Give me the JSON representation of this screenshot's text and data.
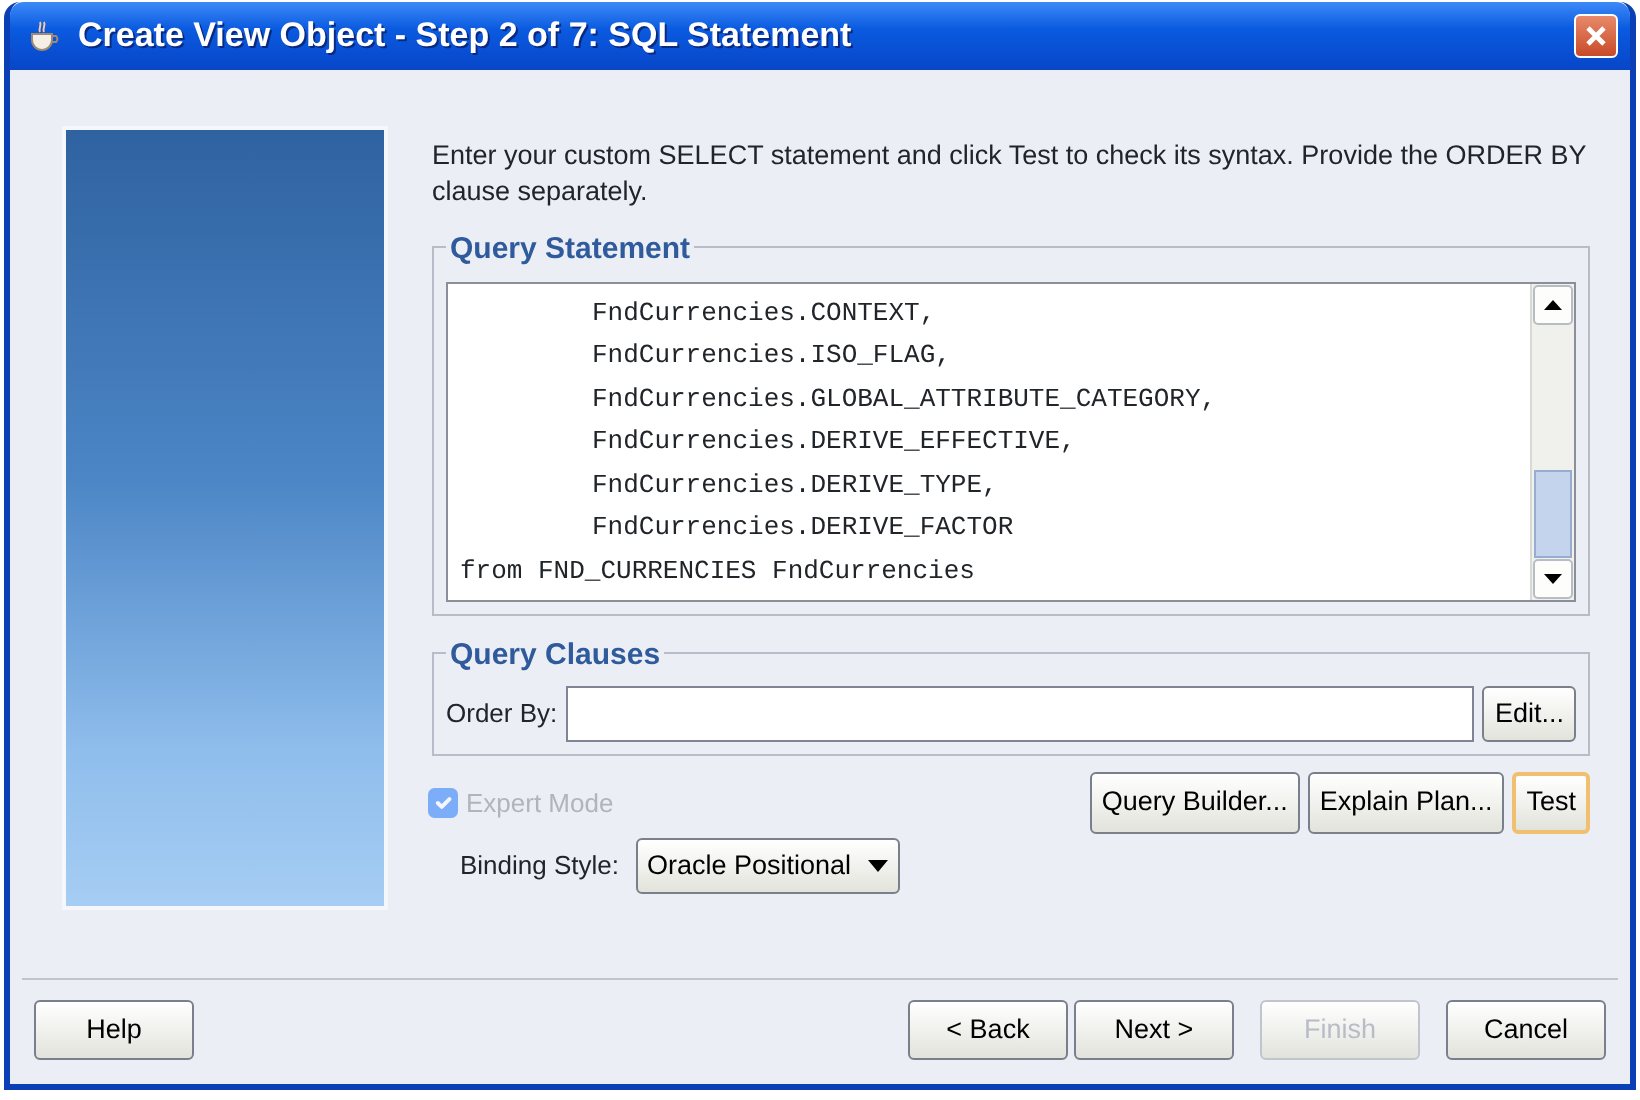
{
  "window": {
    "title": "Create View Object - Step 2 of 7: SQL Statement"
  },
  "instructions": "Enter your custom SELECT statement and click Test to check its syntax.  Provide the ORDER BY clause separately.",
  "query_statement": {
    "title": "Query Statement",
    "lines": [
      {
        "text": "FndCurrencies.CONTEXT,",
        "indented": true
      },
      {
        "text": "FndCurrencies.ISO_FLAG,",
        "indented": true
      },
      {
        "text": "FndCurrencies.GLOBAL_ATTRIBUTE_CATEGORY,",
        "indented": true
      },
      {
        "text": "FndCurrencies.DERIVE_EFFECTIVE,",
        "indented": true
      },
      {
        "text": "FndCurrencies.DERIVE_TYPE,",
        "indented": true
      },
      {
        "text": "FndCurrencies.DERIVE_FACTOR",
        "indented": true
      },
      {
        "text": "from FND_CURRENCIES FndCurrencies",
        "indented": false
      }
    ]
  },
  "query_clauses": {
    "title": "Query Clauses",
    "order_by_label": "Order By:",
    "edit_button": "Edit..."
  },
  "expert_mode": {
    "label": "Expert Mode",
    "checked": true,
    "disabled": true
  },
  "action_buttons": [
    {
      "label": "Query Builder...",
      "default": false
    },
    {
      "label": "Explain Plan...",
      "default": false
    },
    {
      "label": "Test",
      "default": true
    }
  ],
  "binding_style": {
    "label": "Binding Style:",
    "value": "Oracle Positional"
  },
  "footer_buttons": [
    {
      "label": "Help",
      "disabled": false
    },
    {
      "label": "< Back",
      "disabled": false
    },
    {
      "label": "Next >",
      "disabled": false
    },
    {
      "label": "Finish",
      "disabled": true
    },
    {
      "label": "Cancel",
      "disabled": false
    }
  ]
}
